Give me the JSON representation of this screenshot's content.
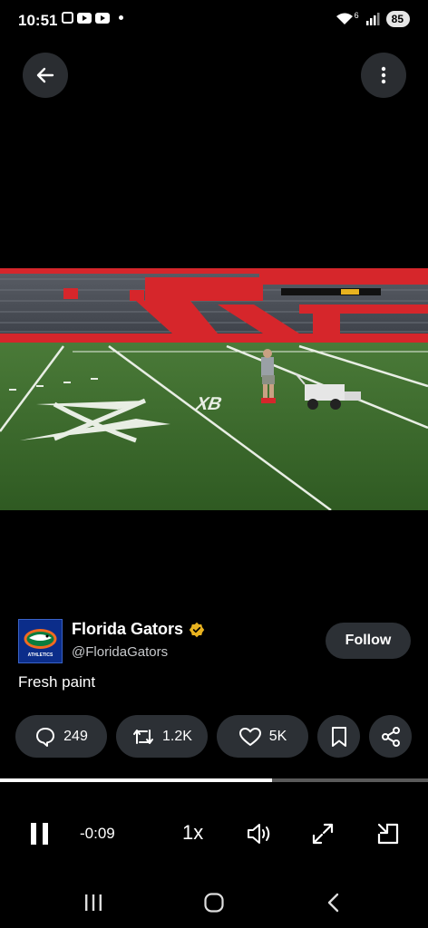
{
  "status_bar": {
    "time": "10:51",
    "battery": "85",
    "signal_label": "6"
  },
  "header": {
    "back_icon": "arrow-left-icon",
    "more_icon": "more-vertical-icon"
  },
  "post": {
    "author_name": "Florida Gators",
    "handle": "@FloridaGators",
    "text": "Fresh paint",
    "follow_label": "Follow",
    "avatar_text": "ATHLETICS",
    "replies": "249",
    "reposts": "1.2K",
    "likes": "5K"
  },
  "player": {
    "progress": 0.635,
    "elapsed": "-0:09",
    "speed": "1x"
  },
  "colors": {
    "background": "#000000",
    "pill": "#2c3035",
    "verified": "#e8b21f",
    "field": "#3d6a2c",
    "stands_red": "#d6262b"
  }
}
